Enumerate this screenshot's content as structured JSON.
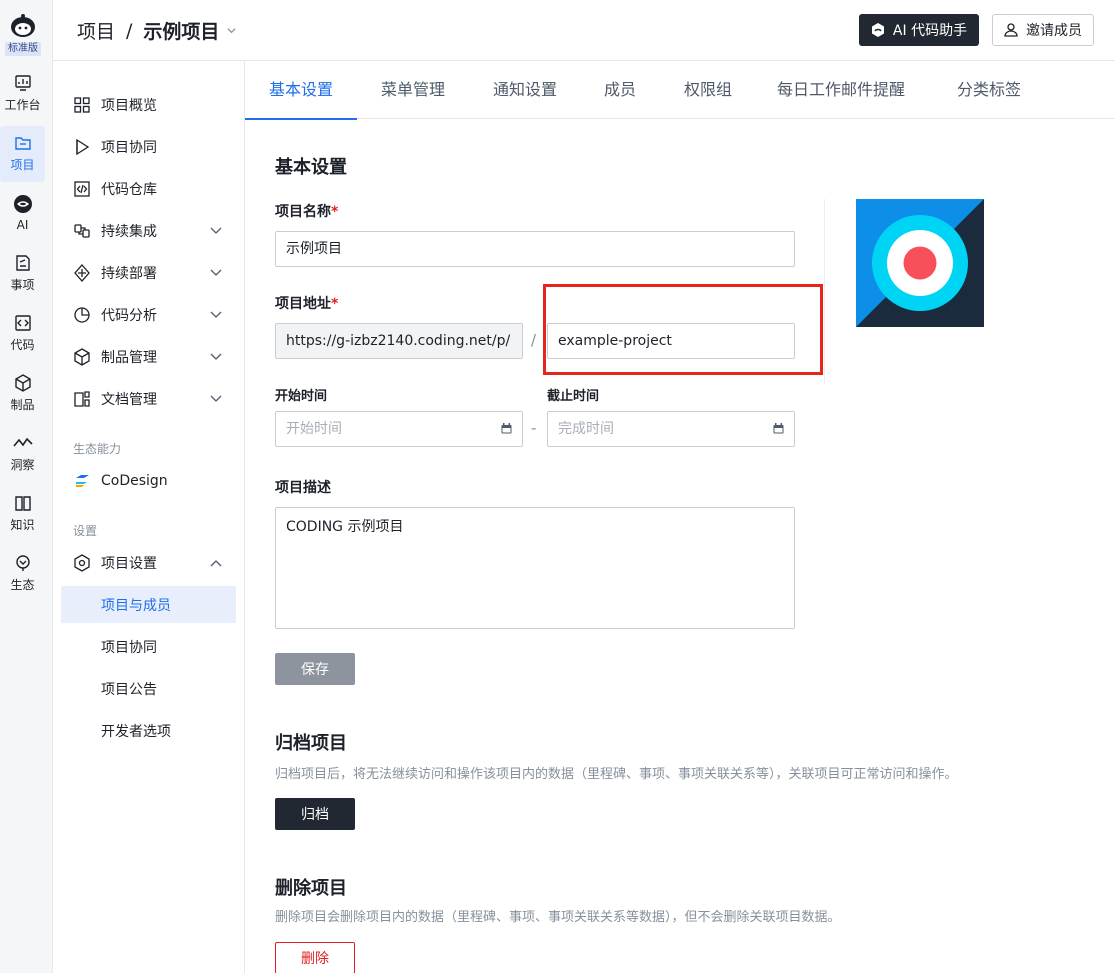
{
  "rail": {
    "edition": "标准版",
    "items": [
      {
        "label": "工作台",
        "icon": "dashboard-icon"
      },
      {
        "label": "项目",
        "icon": "folder-icon"
      },
      {
        "label": "AI",
        "icon": "ai-icon"
      },
      {
        "label": "事项",
        "icon": "issue-icon"
      },
      {
        "label": "代码",
        "icon": "code-icon"
      },
      {
        "label": "制品",
        "icon": "package-icon"
      },
      {
        "label": "洞察",
        "icon": "insight-icon"
      },
      {
        "label": "知识",
        "icon": "book-icon"
      },
      {
        "label": "生态",
        "icon": "ecosystem-icon"
      }
    ]
  },
  "header": {
    "breadcrumb_root": "项目",
    "separator": "/",
    "breadcrumb_current": "示例项目",
    "ai_button": "AI 代码助手",
    "invite_button": "邀请成员"
  },
  "sidenav": {
    "items": [
      {
        "label": "项目概览",
        "icon": "grid-icon"
      },
      {
        "label": "项目协同",
        "icon": "play-icon"
      },
      {
        "label": "代码仓库",
        "icon": "code-file-icon"
      },
      {
        "label": "持续集成",
        "icon": "ci-icon"
      },
      {
        "label": "持续部署",
        "icon": "deploy-icon"
      },
      {
        "label": "代码分析",
        "icon": "analysis-icon"
      },
      {
        "label": "制品管理",
        "icon": "box-icon"
      },
      {
        "label": "文档管理",
        "icon": "doc-icon"
      }
    ],
    "group_eco": "生态能力",
    "codesign": "CoDesign",
    "group_settings": "设置",
    "settings_item": "项目设置",
    "settings_sub": [
      "项目与成员",
      "项目协同",
      "项目公告",
      "开发者选项"
    ]
  },
  "tabs": [
    "基本设置",
    "菜单管理",
    "通知设置",
    "成员",
    "权限组",
    "每日工作邮件提醒",
    "分类标签"
  ],
  "form": {
    "section_title": "基本设置",
    "name_label": "项目名称",
    "name_value": "示例项目",
    "url_label": "项目地址",
    "url_prefix": "https://g-izbz2140.coding.net/p/",
    "url_sep": "/",
    "url_value": "example-project",
    "start_label": "开始时间",
    "start_placeholder": "开始时间",
    "end_label": "截止时间",
    "end_placeholder": "完成时间",
    "date_sep": "-",
    "desc_label": "项目描述",
    "desc_value": "CODING 示例项目",
    "save": "保存",
    "required_mark": "*"
  },
  "archive": {
    "title": "归档项目",
    "desc": "归档项目后，将无法继续访问和操作该项目内的数据（里程碑、事项、事项关联关系等），关联项目可正常访问和操作。",
    "button": "归档"
  },
  "delete": {
    "title": "删除项目",
    "desc": "删除项目会删除项目内的数据（里程碑、事项、事项关联关系等数据），但不会删除关联项目数据。",
    "button": "删除"
  },
  "colors": {
    "primary": "#1f6feb",
    "danger": "#e02020",
    "highlight": "#e5261c",
    "logo_blue": "#0d8ee9",
    "logo_dark": "#1b2a3c",
    "logo_cyan": "#00d4f5",
    "logo_red": "#f7505a"
  }
}
